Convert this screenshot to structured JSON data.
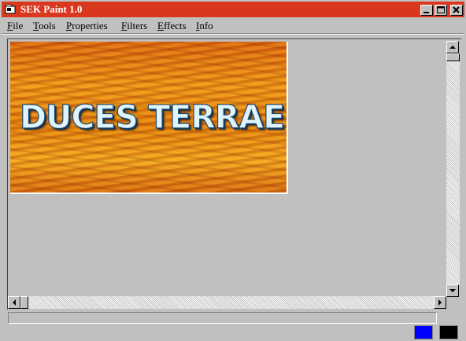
{
  "window": {
    "title": "SEK Paint 1.0",
    "title_bar_color": "#d9381f",
    "controls": [
      "minimize-icon",
      "maximize-icon",
      "close-icon"
    ]
  },
  "menu": {
    "items": [
      {
        "label": "File",
        "accel": "F",
        "rest": "ile"
      },
      {
        "label": "Tools",
        "accel": "T",
        "rest": "ools"
      },
      {
        "label": "Properties",
        "accel": "P",
        "rest": "roperties"
      },
      {
        "label": "Filters",
        "accel": "F",
        "rest": "ilters"
      },
      {
        "label": "Effects",
        "accel": "E",
        "rest": "ffects"
      },
      {
        "label": "Info",
        "accel": "I",
        "rest": "nfo"
      }
    ]
  },
  "canvas": {
    "image_text": "DUCES TERRAE"
  },
  "status_bar": {
    "text": ""
  },
  "colors": {
    "primary": "#0000ff",
    "secondary": "#000000"
  }
}
